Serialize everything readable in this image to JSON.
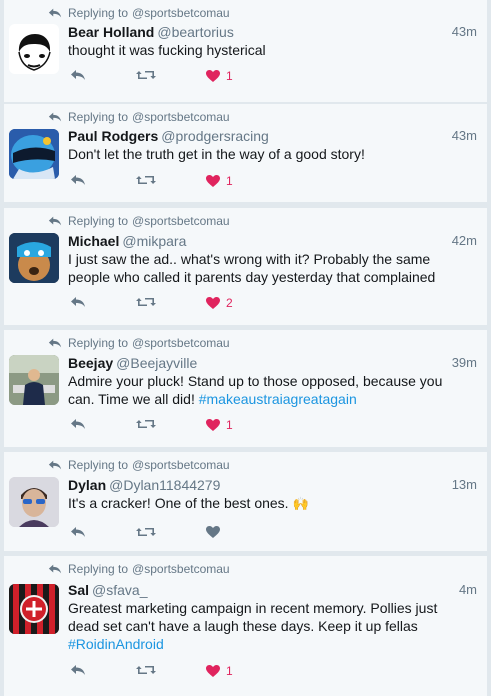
{
  "reply_prefix": "Replying to",
  "reply_target": "@sportsbetcomau",
  "colors": {
    "like_active": "#e0245e",
    "icon_gray": "#657786",
    "link": "#1b95e0"
  },
  "tweets": [
    {
      "name": "Bear Holland",
      "handle": "@beartorius",
      "time": "43m",
      "text": "thought it was fucking hysterical",
      "liked": true,
      "likes": "1",
      "avatar": "cartoon-face-avatar"
    },
    {
      "name": "Paul Rodgers",
      "handle": "@prodgersracing",
      "time": "43m",
      "text": "Don't let the truth get in the way of a good story!",
      "liked": true,
      "likes": "1",
      "avatar": "racing-helmet-avatar"
    },
    {
      "name": "Michael",
      "handle": "@mikpara",
      "time": "42m",
      "text_line1": "I just saw the ad.. what's wrong with it? Probably the same",
      "text_line2": "people who called it parents day yesterday that complained",
      "liked": true,
      "likes": "2",
      "avatar": "dog-avatar"
    },
    {
      "name": "Beejay",
      "handle": "@Beejayville",
      "time": "39m",
      "text_line1": "Admire your pluck! Stand up to those opposed, because you",
      "text_line2": "can. Time we all did!",
      "hashtag": "#makeaustraiagreatagain",
      "liked": true,
      "likes": "1",
      "avatar": "person-outdoor-avatar"
    },
    {
      "name": "Dylan",
      "handle": "@Dylan11844279",
      "time": "13m",
      "text": "It's a cracker! One of the best ones.",
      "emoji": "🙌",
      "liked": false,
      "likes": "",
      "avatar": "person-sunglasses-avatar"
    },
    {
      "name": "Sal",
      "handle": "@sfava_",
      "time": "4m",
      "text_line1": "Greatest marketing campaign in recent memory. Pollies just",
      "text_line2": "dead set can't have a laugh these days. Keep it up fellas",
      "hashtag": "#RoidinAndroid",
      "liked": true,
      "likes": "1",
      "avatar": "ac-milan-badge-avatar"
    }
  ]
}
